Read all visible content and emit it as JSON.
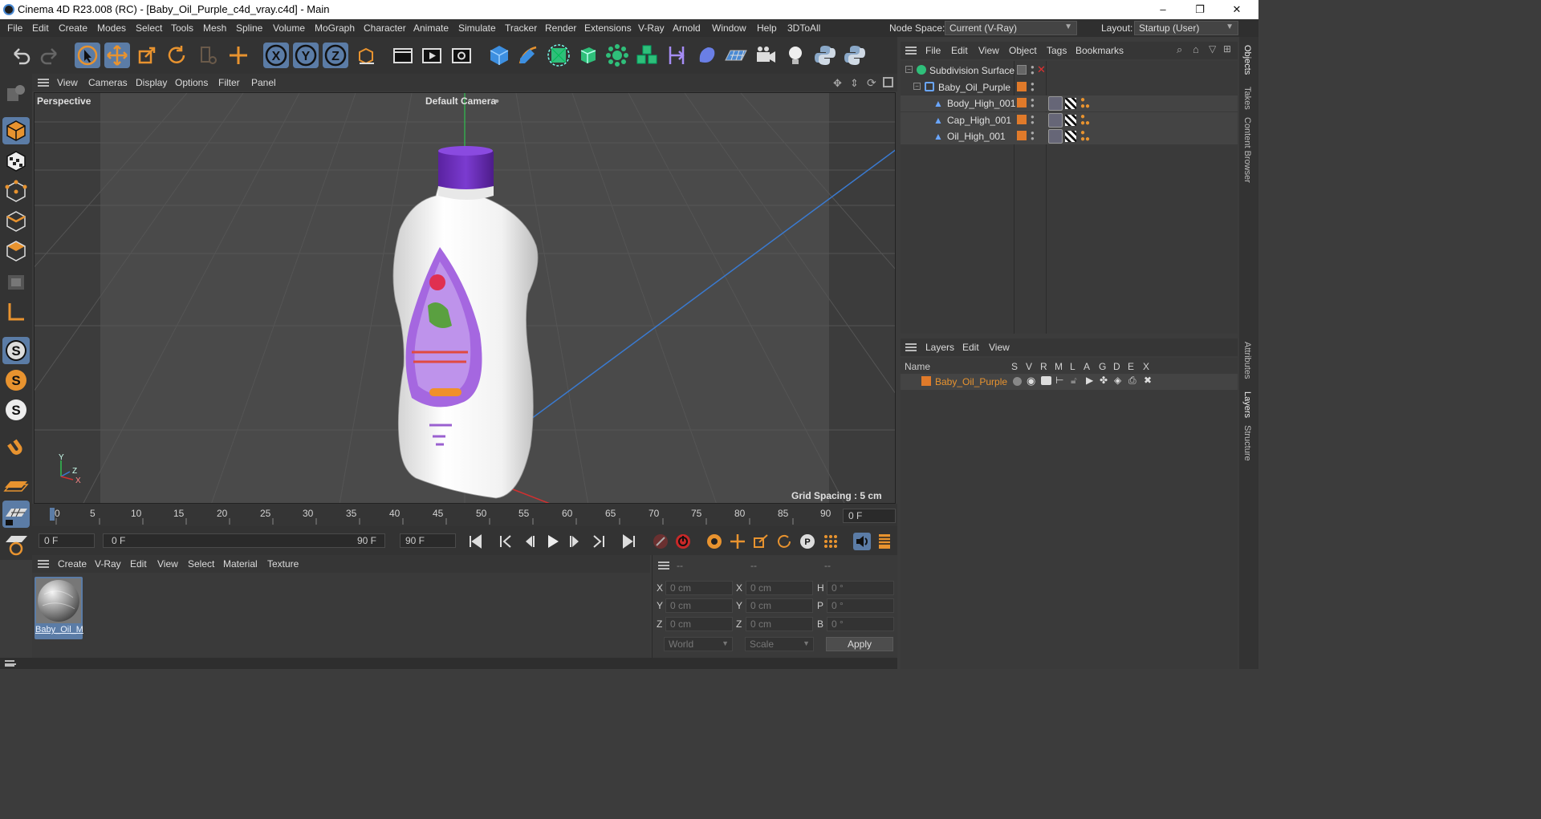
{
  "window": {
    "title": "Cinema 4D R23.008 (RC) - [Baby_Oil_Purple_c4d_vray.c4d] - Main",
    "minimize": "–",
    "maximize": "❐",
    "close": "✕"
  },
  "menubar": {
    "items": [
      "File",
      "Edit",
      "Create",
      "Modes",
      "Select",
      "Tools",
      "Mesh",
      "Spline",
      "Volume",
      "MoGraph",
      "Character",
      "Animate",
      "Simulate",
      "Tracker",
      "Render",
      "Extensions",
      "V-Ray",
      "Arnold",
      "Window",
      "Help",
      "3DToAll"
    ],
    "node_space_label": "Node Space:",
    "node_space_value": "Current (V-Ray)",
    "layout_label": "Layout:",
    "layout_value": "Startup (User)"
  },
  "viewport": {
    "menu": [
      "View",
      "Cameras",
      "Display",
      "Options",
      "Filter",
      "Panel"
    ],
    "view_name": "Perspective",
    "camera": "Default Camera",
    "grid_spacing": "Grid Spacing : 5 cm",
    "axis_y": "Y",
    "axis_z": "Z",
    "axis_x": "X"
  },
  "timeline": {
    "ticks": [
      "0",
      "5",
      "10",
      "15",
      "20",
      "25",
      "30",
      "35",
      "40",
      "45",
      "50",
      "55",
      "60",
      "65",
      "70",
      "75",
      "80",
      "85",
      "90"
    ],
    "current_frame_right": "0 F",
    "start_field": "0 F",
    "range_start": "0 F",
    "range_end": "90 F",
    "end_field": "90 F"
  },
  "material_manager": {
    "menu": [
      "Create",
      "V-Ray",
      "Edit",
      "View",
      "Select",
      "Material",
      "Texture"
    ],
    "materials": [
      {
        "name": "Baby_Oil_M"
      }
    ]
  },
  "coordinates": {
    "header": [
      "--",
      "--",
      "--"
    ],
    "rows": [
      {
        "l1": "X",
        "v1": "0 cm",
        "l2": "X",
        "v2": "0 cm",
        "l3": "H",
        "v3": "0 °"
      },
      {
        "l1": "Y",
        "v1": "0 cm",
        "l2": "Y",
        "v2": "0 cm",
        "l3": "P",
        "v3": "0 °"
      },
      {
        "l1": "Z",
        "v1": "0 cm",
        "l2": "Z",
        "v2": "0 cm",
        "l3": "B",
        "v3": "0 °"
      }
    ],
    "world": "World",
    "scale": "Scale",
    "apply": "Apply"
  },
  "object_manager": {
    "menu": [
      "File",
      "Edit",
      "View",
      "Object",
      "Tags",
      "Bookmarks"
    ],
    "objects": [
      {
        "name": "Subdivision Surface"
      },
      {
        "name": "Baby_Oil_Purple"
      },
      {
        "name": "Body_High_001"
      },
      {
        "name": "Cap_High_001"
      },
      {
        "name": "Oil_High_001"
      }
    ]
  },
  "layers": {
    "menu": [
      "Layers",
      "Edit",
      "View"
    ],
    "name_col": "Name",
    "flag_cols": [
      "S",
      "V",
      "R",
      "M",
      "L",
      "A",
      "G",
      "D",
      "E",
      "X"
    ],
    "items": [
      {
        "name": "Baby_Oil_Purple"
      }
    ]
  },
  "side_tabs": [
    "Objects",
    "Takes",
    "Content Browser",
    "Attributes",
    "Layers",
    "Structure"
  ],
  "colors": {
    "accent_orange": "#e07a2a",
    "selection_blue": "#5b7ca6",
    "cap_purple": "#6a2fb0",
    "label_purple": "#a567e0"
  }
}
